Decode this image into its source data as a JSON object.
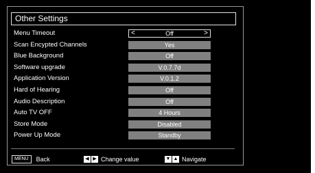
{
  "menu": {
    "title": "Other Settings",
    "items": [
      {
        "label": "Menu Timeout",
        "value": "Off"
      },
      {
        "label": "Scan Encypted Channels",
        "value": "Yes"
      },
      {
        "label": "Blue Background",
        "value": "Off"
      },
      {
        "label": "Software upgrade",
        "value": "V.0.7.7d"
      },
      {
        "label": "Application Version",
        "value": "V.0.1.2"
      },
      {
        "label": "Hard of Hearing",
        "value": "Off"
      },
      {
        "label": "Audio Description",
        "value": "Off"
      },
      {
        "label": "Auto TV OFF",
        "value": "4 Hours"
      },
      {
        "label": "Store Mode",
        "value": "Disabled"
      },
      {
        "label": "Power Up Mode",
        "value": "Standby"
      }
    ],
    "selected_arrows": {
      "left": "<",
      "right": ">"
    }
  },
  "footer": {
    "back_key": "MENU",
    "back_label": "Back",
    "change_label": "Change value",
    "navigate_label": "Navigate",
    "left_right_glyphs": [
      "◀",
      "▶"
    ],
    "down_up_glyphs": [
      "▼",
      "▲"
    ]
  }
}
